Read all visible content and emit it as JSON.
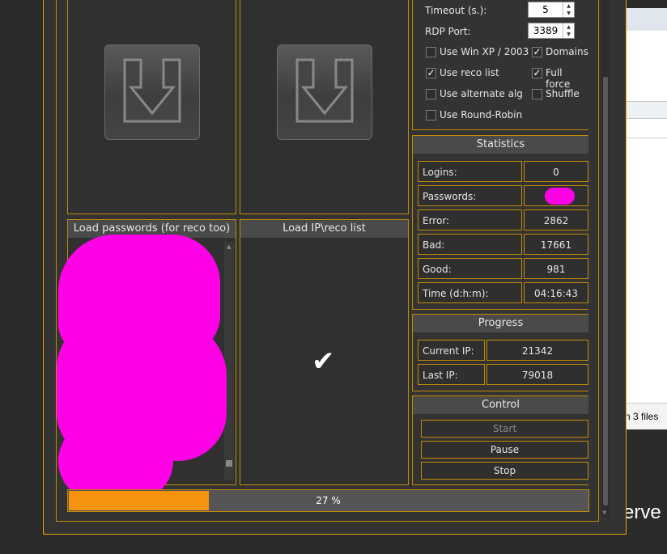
{
  "options": {
    "timeout_label": "Timeout (s.):",
    "timeout_value": "5",
    "rdp_port_label": "RDP Port:",
    "rdp_port_value": "3389",
    "checkboxes": [
      {
        "label": "Use Win XP / 2003",
        "checked": false
      },
      {
        "label": "Domains",
        "checked": true
      },
      {
        "label": "Use reco list",
        "checked": true
      },
      {
        "label": "Full force",
        "checked": true
      },
      {
        "label": "Use alternate alg",
        "checked": false
      },
      {
        "label": "Shuffle",
        "checked": false
      },
      {
        "label": "Use Round-Robin",
        "checked": false
      }
    ],
    "check_mark": "✓"
  },
  "statistics": {
    "title": "Statistics",
    "rows": [
      {
        "label": "Logins:",
        "value": "0"
      },
      {
        "label": "Passwords:",
        "value": ""
      },
      {
        "label": "Error:",
        "value": "2862"
      },
      {
        "label": "Bad:",
        "value": "17661"
      },
      {
        "label": "Good:",
        "value": "981"
      },
      {
        "label": "Time (d:h:m):",
        "value": "04:16:43"
      }
    ]
  },
  "progress_panel": {
    "title": "Progress",
    "rows": [
      {
        "label": "Current IP:",
        "value": "21342"
      },
      {
        "label": "Last IP:",
        "value": "79018"
      }
    ]
  },
  "control": {
    "title": "Control",
    "start": "Start",
    "pause": "Pause",
    "stop": "Stop"
  },
  "lists": {
    "passwords_title": "Load passwords (for reco too)",
    "ip_title": "Load IP\\reco list",
    "ip_status_icon": "✔"
  },
  "progress_bar": {
    "text": "27 %",
    "fraction": 0.27,
    "color": "#f5930f"
  },
  "background_window": {
    "status_text": "n 3 files",
    "partial_text": "erve"
  },
  "colors": {
    "accent": "#c58a00",
    "redaction": "#ff00e6"
  }
}
